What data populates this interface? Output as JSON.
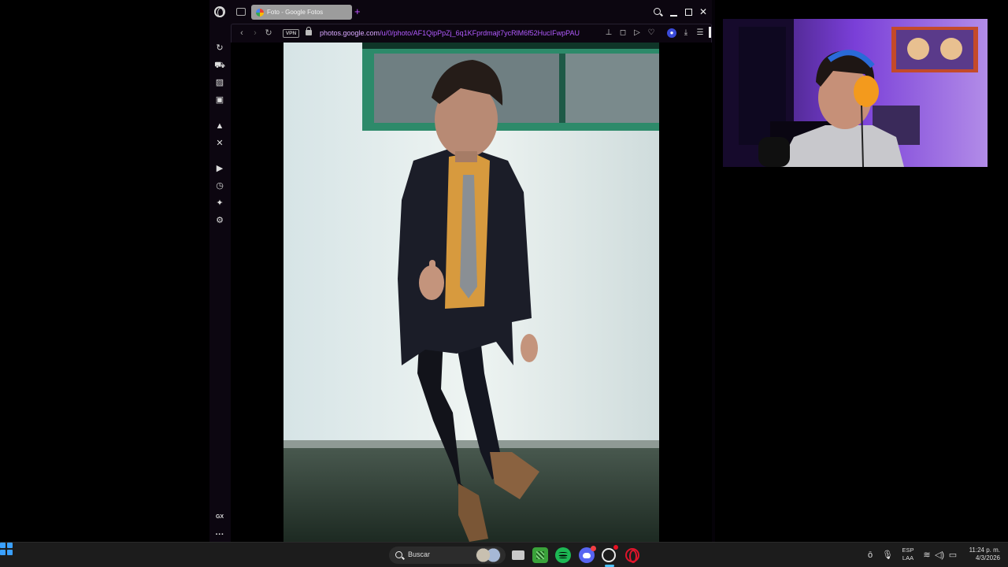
{
  "browser": {
    "tab_title": "Foto - Google Fotos",
    "new_tab_symbol": "+",
    "url_host": "photos.google.com",
    "url_path": "/u/0/photo/AF1QipPpZj_6q1KFprdmajt7ycRlM6f52HucIFwpPAU",
    "vpn_label": "VPN",
    "sidebar_items": [
      "history-icon",
      "shopping-icon",
      "wallet-icon",
      "twitch-icon",
      "ai-icon",
      "x-twitter-icon",
      "player-icon",
      "clock-icon",
      "extensions-icon",
      "settings-icon"
    ],
    "sidebar_bottom": [
      "gx-corner-icon",
      "more-icon"
    ],
    "gx_label": "GX",
    "more_symbol": "···"
  },
  "photo": {
    "subject": "boy-in-suit",
    "accent_colors": {
      "wall": "#dfe8e6",
      "window_frame": "#2d8a6a",
      "suit": "#1a1c26",
      "shirt": "#d79a3e",
      "grass": "#2c3a30"
    }
  },
  "webcam": {
    "subject": "streamer-with-orange-headset",
    "accent_colors": {
      "background": "#7a3fd8",
      "headset": "#f39a1d"
    }
  },
  "taskbar": {
    "search_label": "Buscar",
    "apps": [
      "start-icon",
      "file-explorer-icon",
      "minecraft-icon",
      "spotify-icon",
      "discord-icon",
      "opera-gx-icon",
      "opera-icon"
    ],
    "lang_line1": "ESP",
    "lang_line2": "LAA",
    "time": "11:24 p. m.",
    "date": "4/3/2026"
  },
  "colors": {
    "accent": "#b25bff",
    "taskbar_bg": "#1c1c1c",
    "browser_bg": "#0c0610"
  }
}
